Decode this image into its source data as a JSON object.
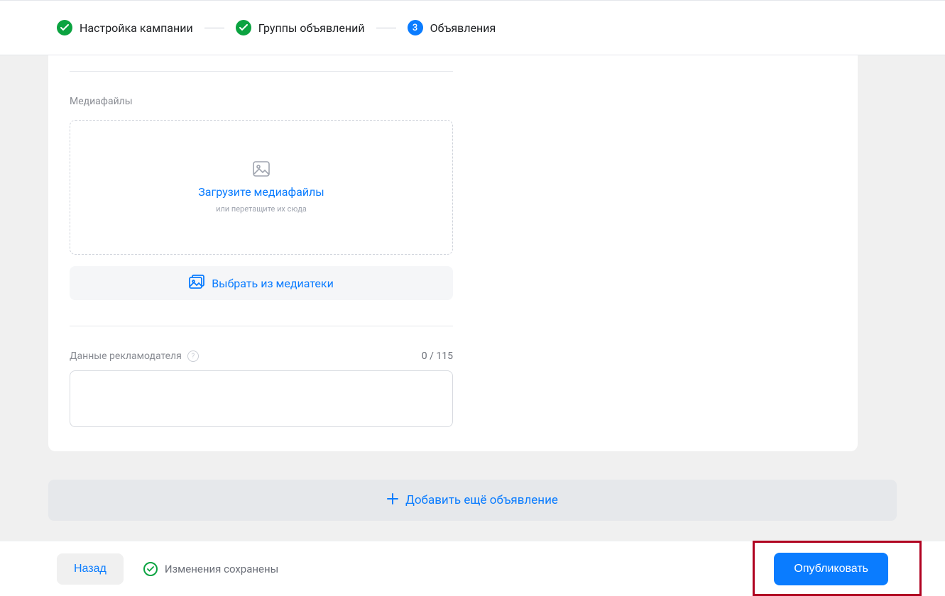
{
  "stepper": {
    "step1": {
      "label": "Настройка кампании"
    },
    "step2": {
      "label": "Группы объявлений"
    },
    "step3": {
      "number": "3",
      "label": "Объявления"
    }
  },
  "media": {
    "section_label": "Медиафайлы",
    "upload_title": "Загрузите медиафайлы",
    "upload_sub": "или перетащите их сюда",
    "library_btn": "Выбрать из медиатеки"
  },
  "advertiser": {
    "label": "Данные рекламодателя",
    "counter": "0 / 115",
    "value": ""
  },
  "add_bar": {
    "label": "Добавить ещё объявление"
  },
  "footer": {
    "back": "Назад",
    "status": "Изменения сохранены",
    "publish": "Опубликовать"
  }
}
